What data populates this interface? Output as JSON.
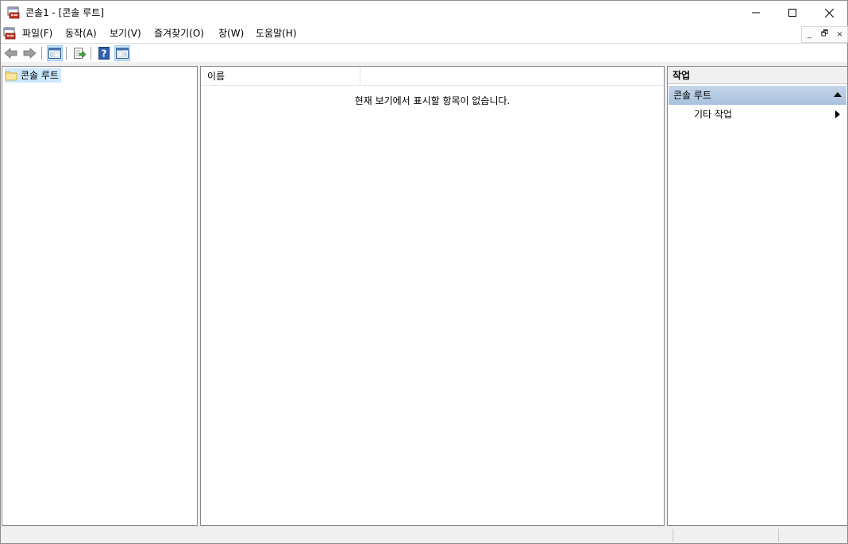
{
  "window": {
    "title": "콘솔1 - [콘솔 루트]",
    "icon": "mmc-console-icon",
    "controls": {
      "minimize": "minimize-icon",
      "maximize": "maximize-icon",
      "close": "close-icon"
    }
  },
  "menubar": {
    "items": [
      {
        "label": "파일(F)",
        "name": "menu-file"
      },
      {
        "label": "동작(A)",
        "name": "menu-action"
      },
      {
        "label": "보기(V)",
        "name": "menu-view"
      },
      {
        "label": "즐겨찾기(O)",
        "name": "menu-favorites"
      },
      {
        "label": "창(W)",
        "name": "menu-window"
      },
      {
        "label": "도움말(H)",
        "name": "menu-help"
      }
    ],
    "mdi_controls": {
      "minimize": "_",
      "restore": "🗗",
      "close": "×"
    }
  },
  "toolbar": {
    "buttons": [
      "back-icon",
      "forward-icon",
      "show-hide-console-tree-icon",
      "export-list-icon",
      "help-icon",
      "show-hide-action-pane-icon"
    ]
  },
  "tree": {
    "root_label": "콘솔 루트"
  },
  "list": {
    "column_name": "이름",
    "empty_message": "현재 보기에서 표시할 항목이 없습니다."
  },
  "actions": {
    "header": "작업",
    "section_title": "콘솔 루트",
    "items": [
      {
        "label": "기타 작업"
      }
    ]
  },
  "colors": {
    "selection": "#cce8ff",
    "section_header": "#b6cce6",
    "pressed_button": "#cce4f7"
  }
}
